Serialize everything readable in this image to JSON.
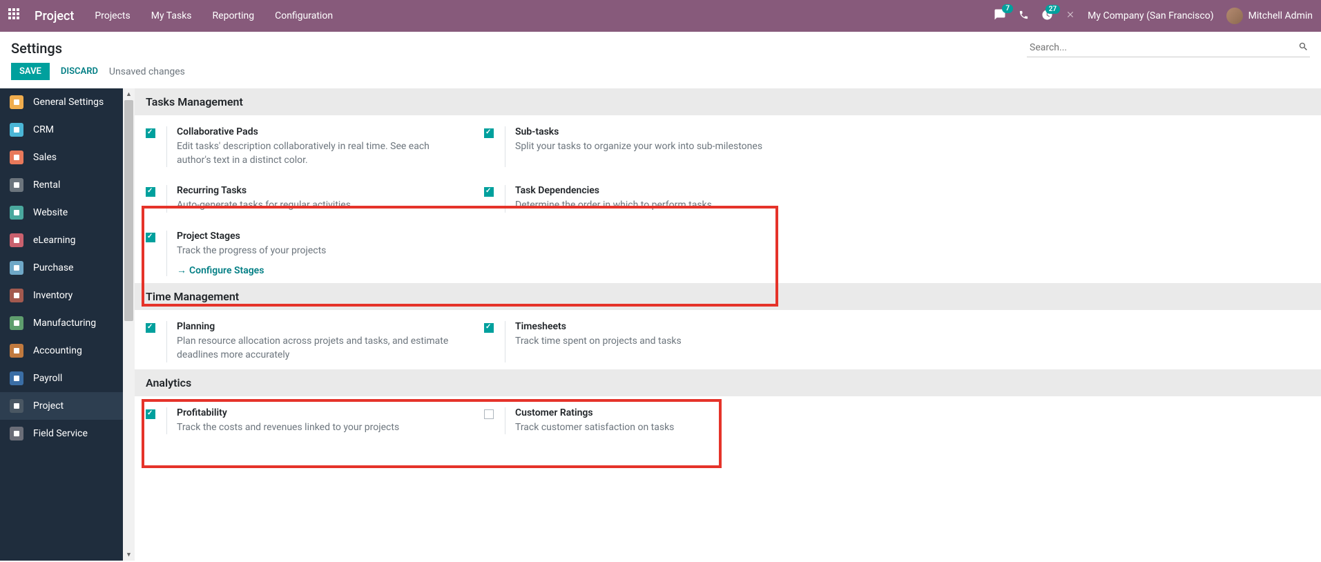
{
  "topnav": {
    "brand": "Project",
    "menu": [
      "Projects",
      "My Tasks",
      "Reporting",
      "Configuration"
    ],
    "msg_badge": "7",
    "activity_badge": "27",
    "company": "My Company (San Francisco)",
    "user": "Mitchell Admin"
  },
  "cp": {
    "title": "Settings",
    "save": "SAVE",
    "discard": "DISCARD",
    "status": "Unsaved changes",
    "search_placeholder": "Search..."
  },
  "sidebar": [
    {
      "label": "General Settings",
      "color": "#f0ad4e"
    },
    {
      "label": "CRM",
      "color": "#4bb6d6"
    },
    {
      "label": "Sales",
      "color": "#e8795b"
    },
    {
      "label": "Rental",
      "color": "#6c757d"
    },
    {
      "label": "Website",
      "color": "#4aa89e"
    },
    {
      "label": "eLearning",
      "color": "#c9616e"
    },
    {
      "label": "Purchase",
      "color": "#6fa8c7"
    },
    {
      "label": "Inventory",
      "color": "#a35a4f"
    },
    {
      "label": "Manufacturing",
      "color": "#5f9e6e"
    },
    {
      "label": "Accounting",
      "color": "#c17a3f"
    },
    {
      "label": "Payroll",
      "color": "#3b6ea5"
    },
    {
      "label": "Project",
      "color": "#4a5763",
      "active": true
    },
    {
      "label": "Field Service",
      "color": "#6b6e78"
    }
  ],
  "sections": {
    "tasks": {
      "header": "Tasks Management",
      "items": [
        {
          "title": "Collaborative Pads",
          "desc": "Edit tasks' description collaboratively in real time. See each author's text in a distinct color.",
          "checked": true
        },
        {
          "title": "Sub-tasks",
          "desc": "Split your tasks to organize your work into sub-milestones",
          "checked": true
        },
        {
          "title": "Recurring Tasks",
          "desc": "Auto-generate tasks for regular activities",
          "checked": true
        },
        {
          "title": "Task Dependencies",
          "desc": "Determine the order in which to perform tasks",
          "checked": true
        },
        {
          "title": "Project Stages",
          "desc": "Track the progress of your projects",
          "checked": true,
          "link": "Configure Stages"
        }
      ]
    },
    "time": {
      "header": "Time Management",
      "items": [
        {
          "title": "Planning",
          "desc": "Plan resource allocation across projets and tasks, and estimate deadlines more accurately",
          "checked": true
        },
        {
          "title": "Timesheets",
          "desc": "Track time spent on projects and tasks",
          "checked": true
        }
      ]
    },
    "analytics": {
      "header": "Analytics",
      "items": [
        {
          "title": "Profitability",
          "desc": "Track the costs and revenues linked to your projects",
          "checked": true
        },
        {
          "title": "Customer Ratings",
          "desc": "Track customer satisfaction on tasks",
          "checked": false
        }
      ]
    }
  }
}
